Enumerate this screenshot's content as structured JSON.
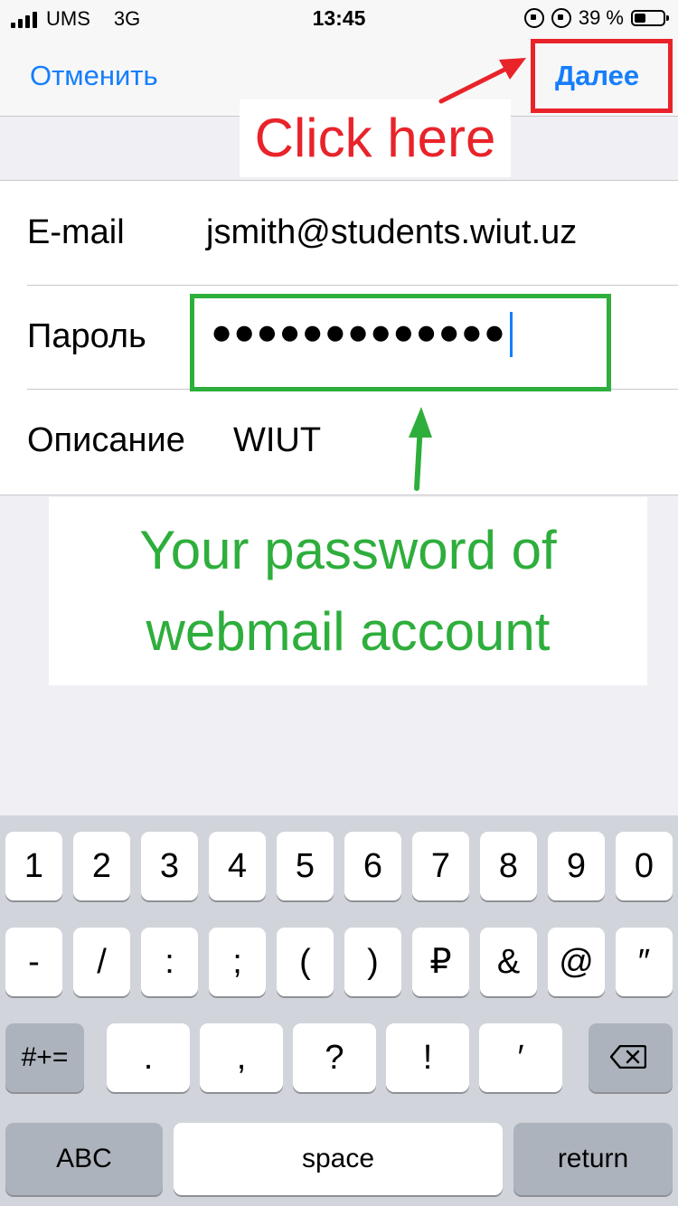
{
  "status_bar": {
    "carrier": "UMS",
    "network": "3G",
    "time": "13:45",
    "battery_percent": "39 %",
    "battery_level": 0.39,
    "icons": [
      "signal-bars-icon",
      "orientation-lock-icon",
      "alarm-icon",
      "battery-icon"
    ]
  },
  "nav": {
    "cancel_label": "Отменить",
    "next_label": "Далее",
    "accent_color": "#157efb"
  },
  "form": {
    "email_label": "E-mail",
    "email_value": "jsmith@students.wiut.uz",
    "password_label": "Пароль",
    "password_value": "●●●●●●●●●●●●●",
    "description_label": "Описание",
    "description_value": "WIUT"
  },
  "annotations": {
    "click_here": "Click here",
    "password_hint_line1": "Your password of",
    "password_hint_line2": "webmail account",
    "red_color": "#e8232a",
    "green_color": "#2eae3c"
  },
  "keyboard": {
    "row1": [
      "1",
      "2",
      "3",
      "4",
      "5",
      "6",
      "7",
      "8",
      "9",
      "0"
    ],
    "row2": [
      "-",
      "/",
      ":",
      ";",
      "(",
      ")",
      "₽",
      "&",
      "@",
      "″"
    ],
    "row3_mode": "#+=",
    "row3": [
      ".",
      ",",
      "?",
      "!",
      "′"
    ],
    "row4_abc": "ABC",
    "row4_space": "space",
    "row4_return": "return",
    "backspace_icon": "backspace-icon"
  }
}
